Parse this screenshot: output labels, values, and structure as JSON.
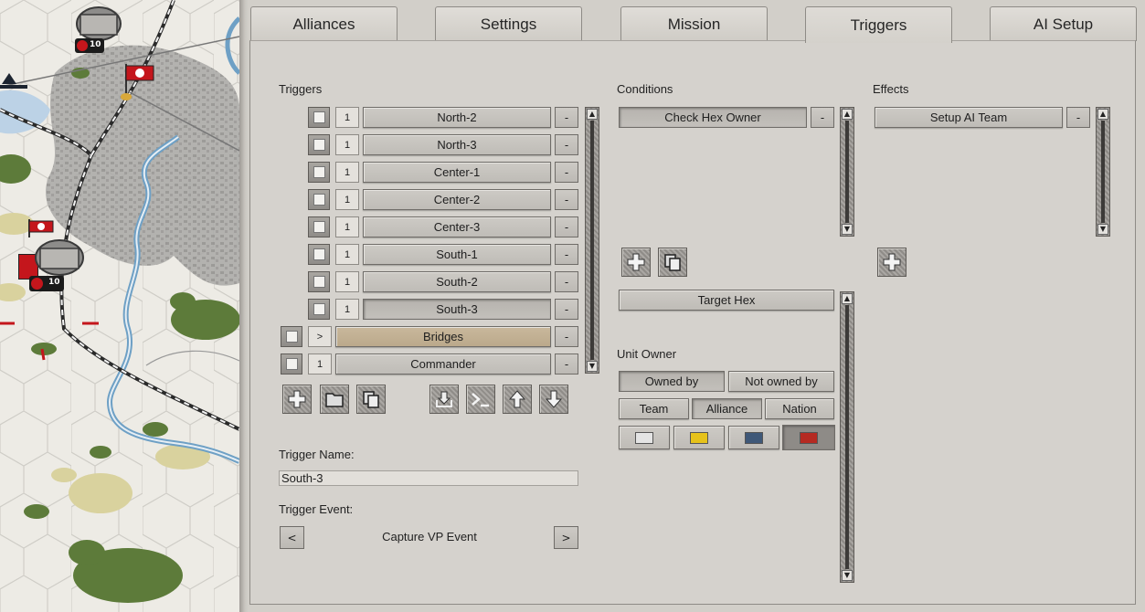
{
  "map": {
    "units": [
      {
        "strength": "10"
      },
      {
        "strength": "10"
      }
    ]
  },
  "tabs": [
    {
      "label": "Alliances"
    },
    {
      "label": "Settings"
    },
    {
      "label": "Mission"
    },
    {
      "label": "Triggers",
      "active": true
    },
    {
      "label": "AI Setup"
    }
  ],
  "triggers": {
    "heading": "Triggers",
    "items": [
      {
        "count": "1",
        "name": "North-2"
      },
      {
        "count": "1",
        "name": "North-3"
      },
      {
        "count": "1",
        "name": "Center-1"
      },
      {
        "count": "1",
        "name": "Center-2"
      },
      {
        "count": "1",
        "name": "Center-3"
      },
      {
        "count": "1",
        "name": "South-1"
      },
      {
        "count": "1",
        "name": "South-2"
      },
      {
        "count": "1",
        "name": "South-3",
        "selected": true
      },
      {
        "count": ">",
        "name": "Bridges",
        "folder": true
      },
      {
        "count": "1",
        "name": "Commander"
      }
    ],
    "remove_label": "-",
    "name_label": "Trigger Name:",
    "name_value": "South-3",
    "event_label": "Trigger Event:",
    "event_value": "Capture VP Event",
    "event_prev": "<",
    "event_next": ">"
  },
  "conditions": {
    "heading": "Conditions",
    "items": [
      {
        "name": "Check Hex Owner"
      }
    ],
    "remove_label": "-",
    "target_label": "Target Hex",
    "unit_owner_label": "Unit Owner",
    "owned_by": "Owned by",
    "not_owned_by": "Not owned by",
    "team": "Team",
    "alliance": "Alliance",
    "nation": "Nation",
    "colors": [
      "#e4e4e4",
      "#e6c21a",
      "#3f5878",
      "#b52a22"
    ]
  },
  "effects": {
    "heading": "Effects",
    "items": [
      {
        "name": "Setup AI Team"
      }
    ],
    "remove_label": "-"
  }
}
